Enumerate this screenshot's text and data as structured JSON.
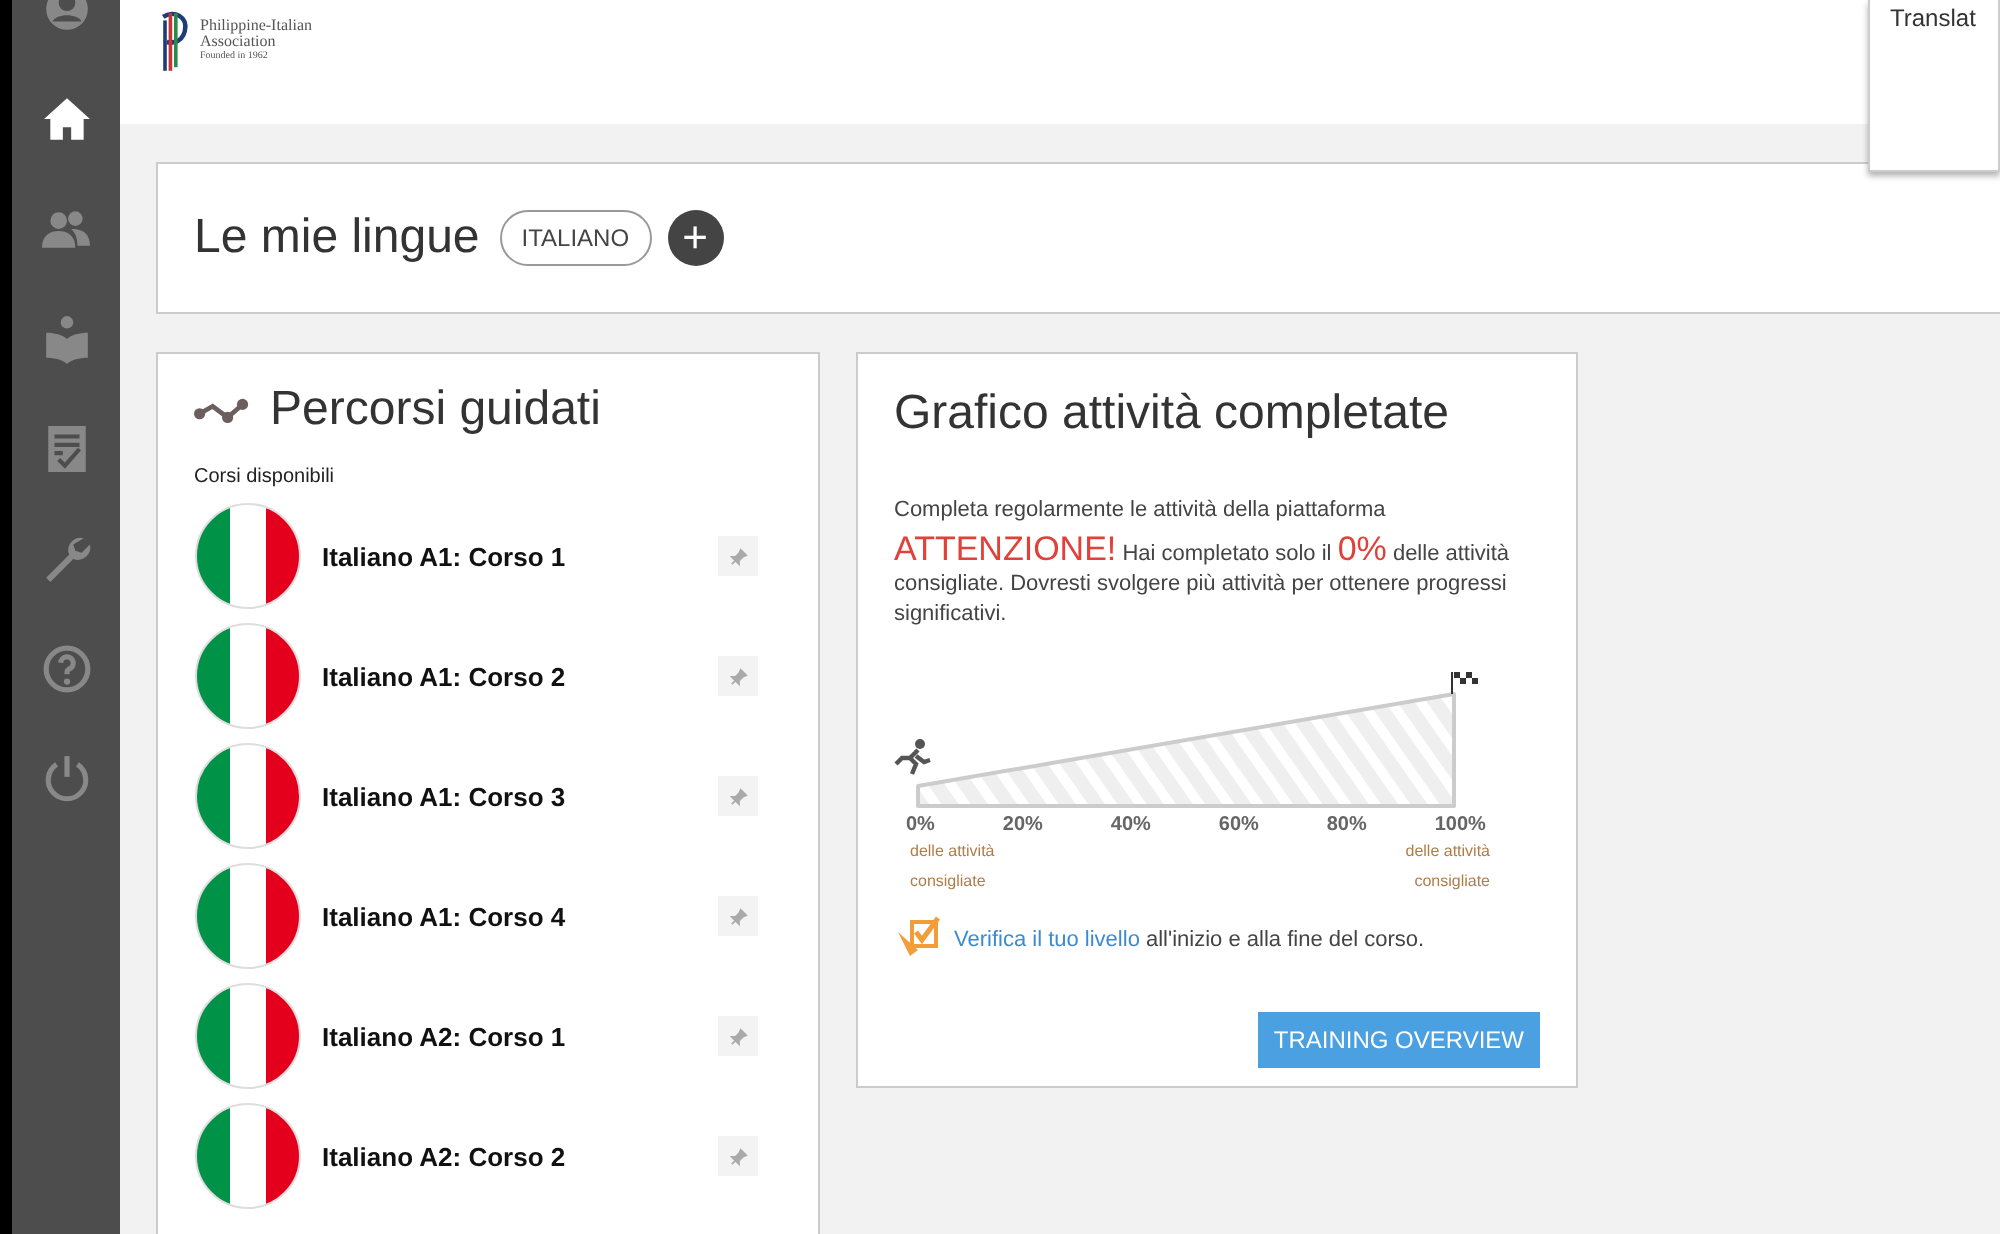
{
  "sidebar": {
    "items": [
      {
        "selected": false
      },
      {
        "selected": true
      },
      {
        "selected": false
      },
      {
        "selected": false
      },
      {
        "selected": false
      },
      {
        "selected": false
      },
      {
        "selected": false
      },
      {
        "selected": false
      }
    ]
  },
  "header": {
    "logo_lines": [
      "Philippine-Italian",
      "Association",
      "Founded in 1962"
    ]
  },
  "popup": {
    "text": "Translat"
  },
  "languages": {
    "title": "Le mie lingue",
    "tags": [
      "ITALIANO"
    ],
    "add_button": "+"
  },
  "guided_paths": {
    "title": "Percorsi guidati",
    "subtitle": "Corsi disponibili",
    "courses": [
      {
        "name": "Italiano A1: Corso 1"
      },
      {
        "name": "Italiano A1: Corso 2"
      },
      {
        "name": "Italiano A1: Corso 3"
      },
      {
        "name": "Italiano A1: Corso 4"
      },
      {
        "name": "Italiano A2: Corso 1"
      },
      {
        "name": "Italiano A2: Corso 2"
      }
    ]
  },
  "activity": {
    "title": "Grafico attività completate",
    "intro": "Completa regolarmente le attività della piattaforma",
    "warning_label": "ATTENZIONE!",
    "warning_text_before": "Hai completato solo il",
    "percent": "0%",
    "warning_text_after": "delle attività consigliate. Dovresti svolgere più attività per ottenere progressi significativi.",
    "progress": {
      "ticks": [
        "0%",
        "20%",
        "40%",
        "60%",
        "80%",
        "100%"
      ],
      "start_caption": "delle attività consigliate",
      "end_caption": "delle attività consigliate"
    },
    "verify_link": "Verifica il tuo livello",
    "verify_text": "all'inizio e alla fine del corso.",
    "button": "TRAINING OVERVIEW"
  }
}
